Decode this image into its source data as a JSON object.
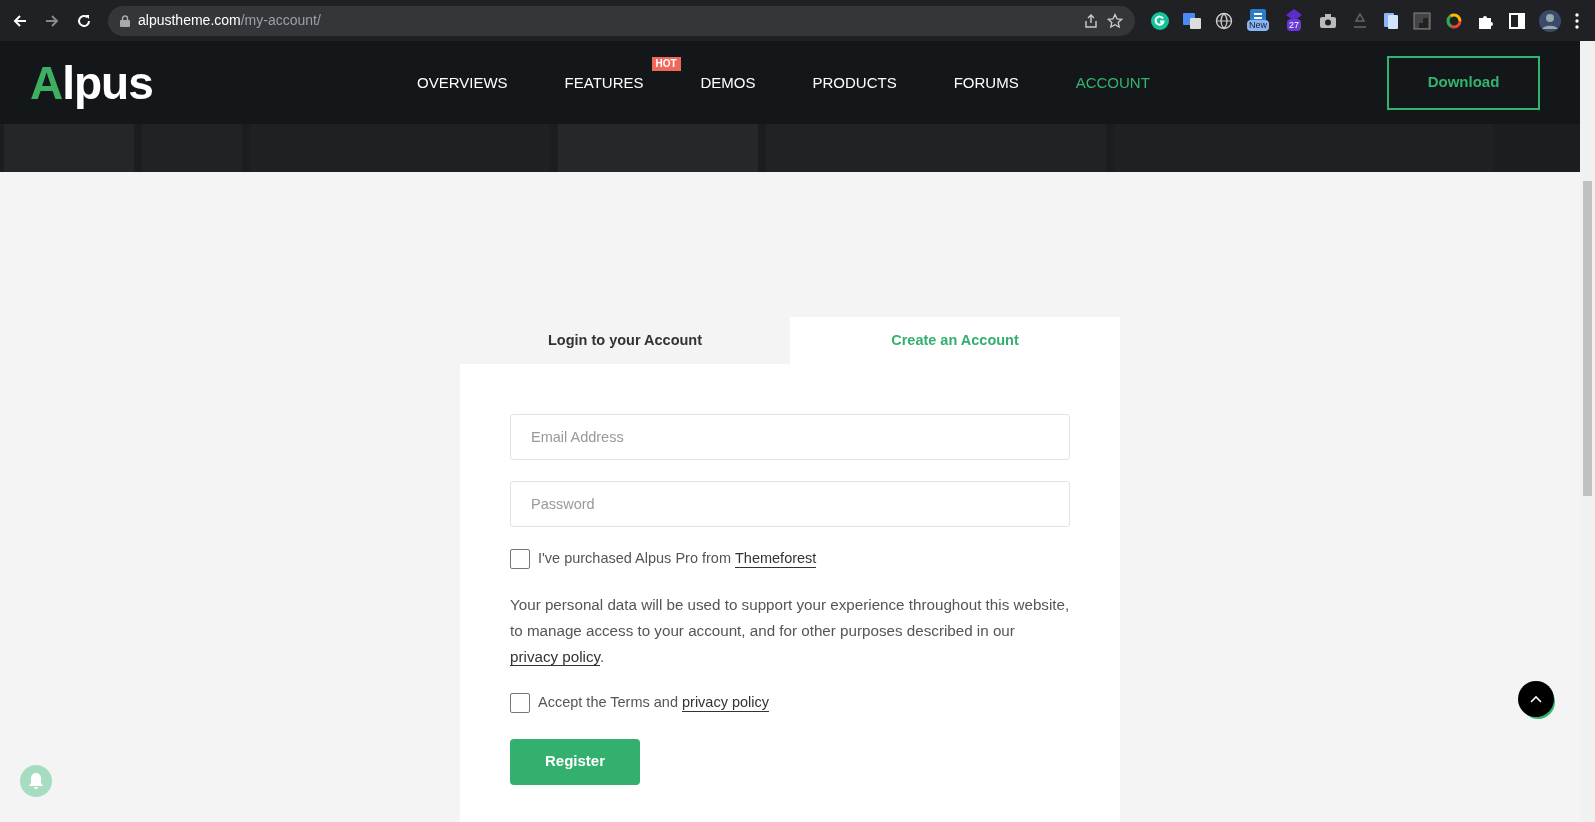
{
  "browser": {
    "url_host": "alpustheme.com",
    "url_path": "/my-account/",
    "badges": [
      "New",
      "27"
    ]
  },
  "header": {
    "logo": "Alpus",
    "nav": [
      {
        "label": "OVERVIEWS",
        "selected": false
      },
      {
        "label": "FEATURES",
        "selected": false,
        "badge": "HOT"
      },
      {
        "label": "DEMOS",
        "selected": false
      },
      {
        "label": "PRODUCTS",
        "selected": false
      },
      {
        "label": "FORUMS",
        "selected": false
      },
      {
        "label": "ACCOUNT",
        "selected": true
      }
    ],
    "download_button": "Download"
  },
  "tabs": [
    {
      "label": "Login to your Account",
      "selected": false
    },
    {
      "label": "Create an Account",
      "selected": true
    }
  ],
  "form": {
    "fields": [
      {
        "placeholder": "Email Address"
      },
      {
        "placeholder": "Password"
      }
    ],
    "purchase_check": {
      "checked": false,
      "text": "I've purchased Alpus Pro from",
      "link": "Themeforest"
    },
    "privacy_note": {
      "text": "Your personal data will be used to support your experience throughout this website, to manage access to your account, and for other purposes described in our",
      "link": "privacy policy",
      "after": "."
    },
    "terms_check": {
      "checked": false,
      "text": "Accept the Terms and",
      "link": "privacy policy"
    },
    "submit": "Register"
  }
}
